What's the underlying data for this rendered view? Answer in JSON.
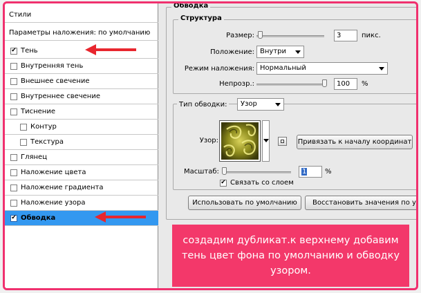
{
  "left_panel": {
    "styles_header": "Стили",
    "blending_header": "Параметры наложения: по умолчанию",
    "items": [
      {
        "label": "Тень",
        "checked": true,
        "indent": 0,
        "selected": false
      },
      {
        "label": "Внутренняя тень",
        "checked": false,
        "indent": 0,
        "selected": false
      },
      {
        "label": "Внешнее свечение",
        "checked": false,
        "indent": 0,
        "selected": false
      },
      {
        "label": "Внутреннее свечение",
        "checked": false,
        "indent": 0,
        "selected": false
      },
      {
        "label": "Тиснение",
        "checked": false,
        "indent": 0,
        "selected": false
      },
      {
        "label": "Контур",
        "checked": false,
        "indent": 1,
        "selected": false
      },
      {
        "label": "Текстура",
        "checked": false,
        "indent": 1,
        "selected": false
      },
      {
        "label": "Глянец",
        "checked": false,
        "indent": 0,
        "selected": false
      },
      {
        "label": "Наложение цвета",
        "checked": false,
        "indent": 0,
        "selected": false
      },
      {
        "label": "Наложение градиента",
        "checked": false,
        "indent": 0,
        "selected": false
      },
      {
        "label": "Наложение узора",
        "checked": false,
        "indent": 0,
        "selected": false
      },
      {
        "label": "Обводка",
        "checked": true,
        "indent": 0,
        "selected": true
      }
    ],
    "check_glyph": "✔"
  },
  "stroke": {
    "group_title": "Обводка",
    "structure_title": "Структура",
    "size_label": "Размер:",
    "size_value": "3",
    "size_unit": "пикс.",
    "position_label": "Положение:",
    "position_value": "Внутри",
    "blend_label": "Режим наложения:",
    "blend_value": "Нормальный",
    "opacity_label": "Непрозр.:",
    "opacity_value": "100",
    "opacity_unit": "%",
    "fill_type_label": "Тип обводки:",
    "fill_type_value": "Узор",
    "pattern_label": "Узор:",
    "snap_button": "Привязать к началу координат",
    "scale_label": "Масштаб:",
    "scale_value": "1",
    "scale_unit": "%",
    "link_label": "Связать со слоем",
    "link_checked": true,
    "default_button": "Использовать по умолчанию",
    "reset_button": "Восстановить значения по умолч"
  },
  "annotation": {
    "text": "создадим дубликат.к верхнему добавим тень цвет фона по умолчанию и обводку узором."
  },
  "colors": {
    "accent": "#f0306e",
    "overlay": "#f3386a",
    "selected": "#3398f0",
    "arrow": "#e8262e"
  }
}
